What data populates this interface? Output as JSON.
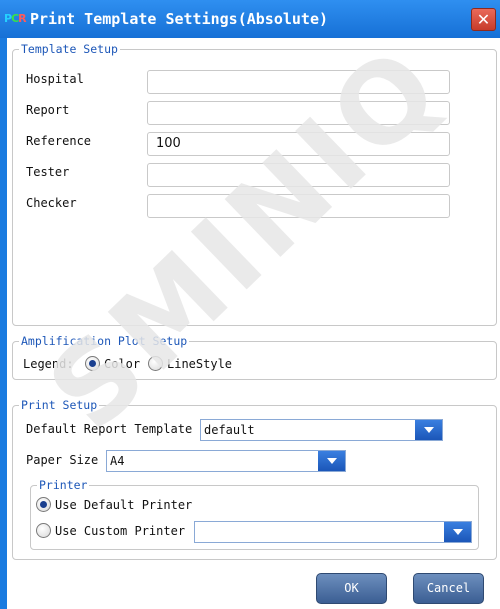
{
  "window": {
    "icon_letters": {
      "p": "P",
      "c": "C",
      "r": "R"
    },
    "title": "Print Template Settings(Absolute)",
    "close_symbol": "✕"
  },
  "template_setup": {
    "legend": "Template Setup",
    "hospital": {
      "label": "Hospital",
      "value": ""
    },
    "report": {
      "label": "Report",
      "value": ""
    },
    "reference": {
      "label": "Reference",
      "value": "100"
    },
    "tester": {
      "label": "Tester",
      "value": ""
    },
    "checker": {
      "label": "Checker",
      "value": ""
    }
  },
  "amplification": {
    "legend": "Amplification Plot Setup",
    "legend_label": "Legend:",
    "option_color": "Color",
    "option_linestyle": "LineStyle",
    "selected": "Color"
  },
  "print_setup": {
    "legend": "Print Setup",
    "default_template_label": "Default Report Template",
    "default_template_value": "default",
    "paper_size_label": "Paper Size",
    "paper_size_value": "A4",
    "printer": {
      "legend": "Printer",
      "use_default": "Use Default Printer",
      "use_custom": "Use Custom Printer",
      "selected": "Use Default Printer",
      "custom_value": ""
    }
  },
  "buttons": {
    "ok": "OK",
    "cancel": "Cancel"
  },
  "watermark": "SMINIQ",
  "colors": {
    "title_bar": "#1a7be0",
    "legend_text": "#1d57b8",
    "close": "#d24a38",
    "button": "#4f71a4"
  }
}
